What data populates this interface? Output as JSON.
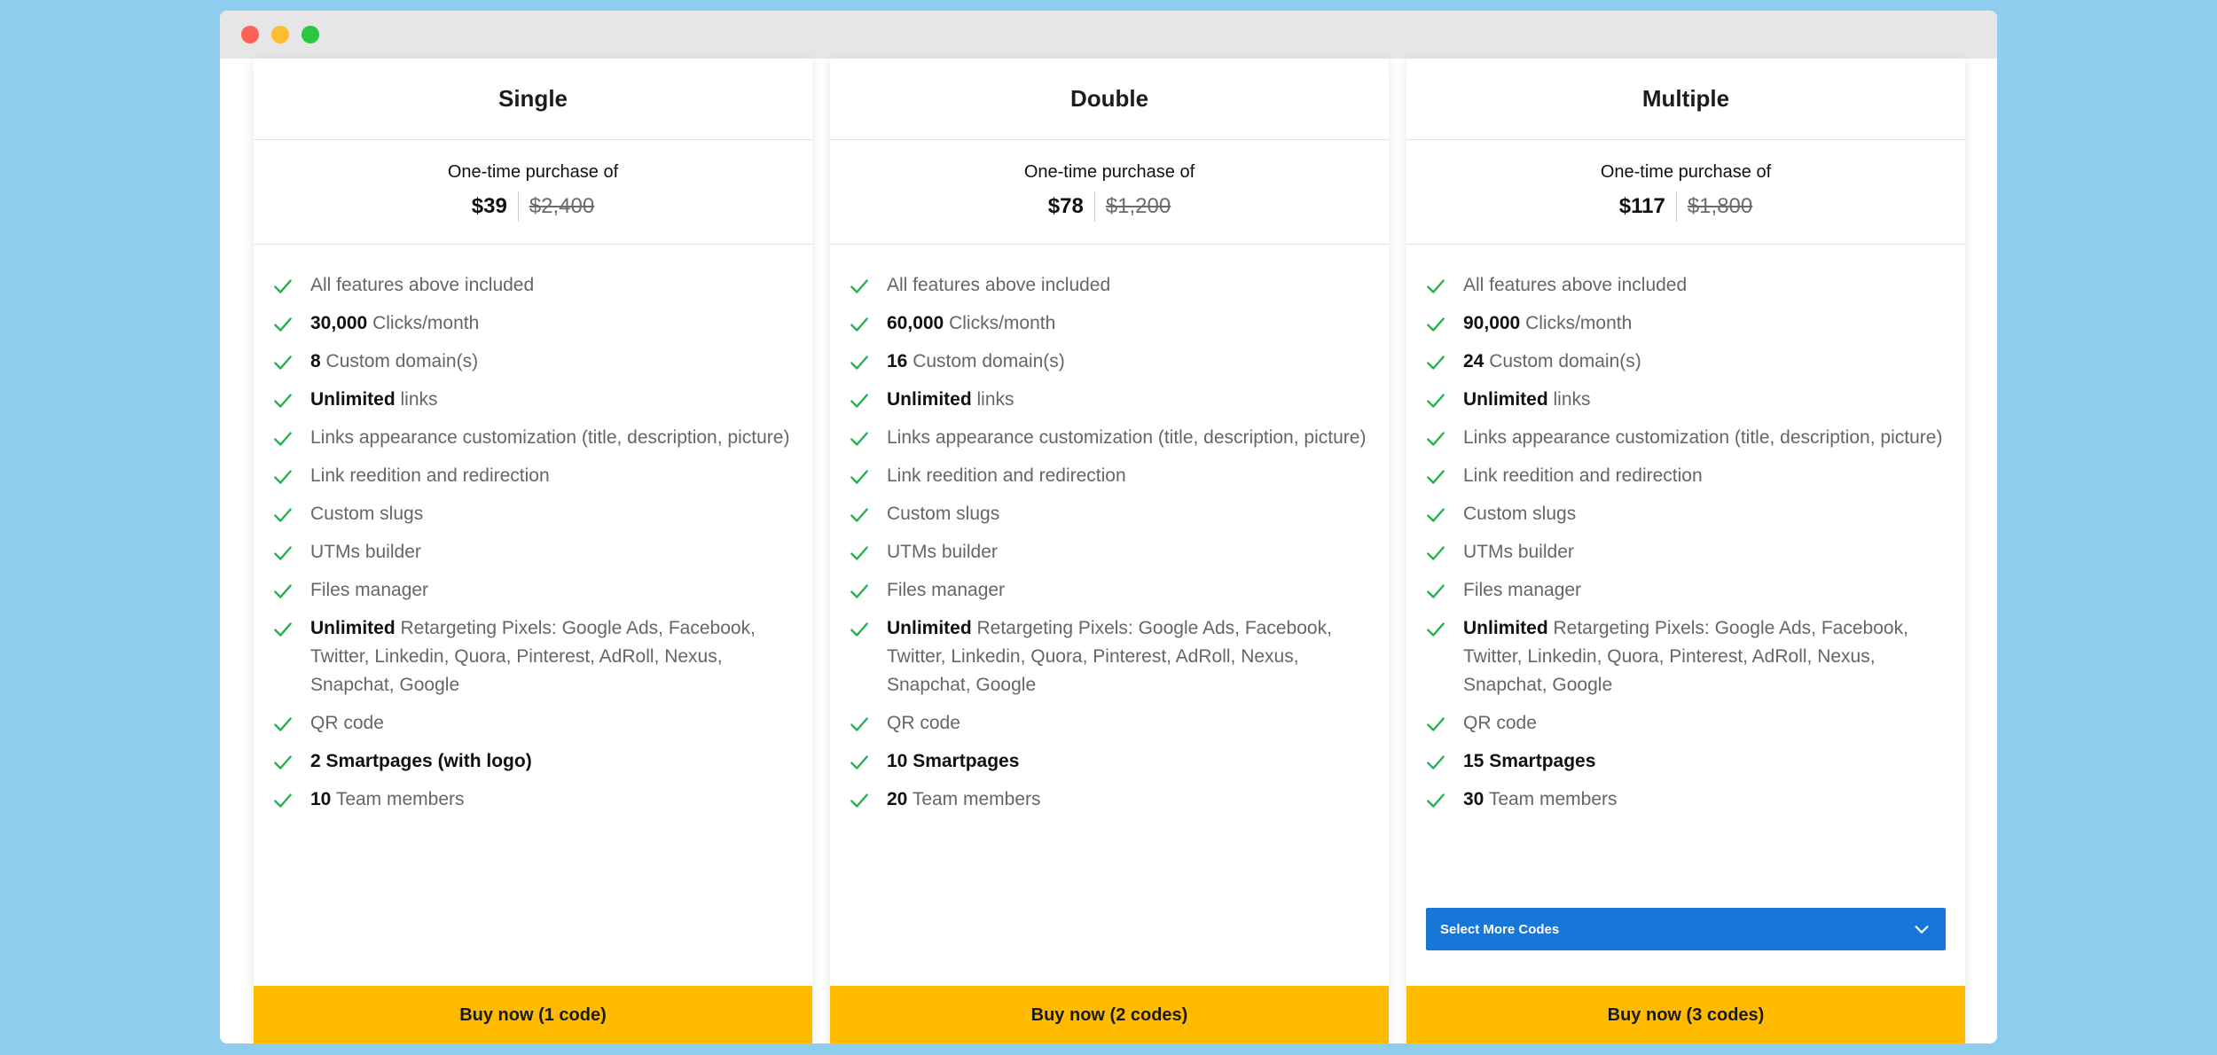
{
  "colors": {
    "accent_blue": "#1677d9",
    "buy_yellow": "#ffbb00",
    "check_green": "#23b14d",
    "background": "#8ecdee"
  },
  "icons": {
    "feature_check": "check-icon",
    "dropdown": "chevron-down-icon"
  },
  "plans": [
    {
      "title": "Single",
      "price_caption": "One-time purchase of",
      "price_now": "$39",
      "price_old": "$2,400",
      "features": [
        {
          "strong": "",
          "text": "All features above included"
        },
        {
          "strong": "30,000",
          "text": " Clicks/month"
        },
        {
          "strong": "8",
          "text": " Custom domain(s)"
        },
        {
          "strong": "Unlimited",
          "text": " links"
        },
        {
          "strong": "",
          "text": "Links appearance customization (title, description, picture)"
        },
        {
          "strong": "",
          "text": "Link reedition and redirection"
        },
        {
          "strong": "",
          "text": "Custom slugs"
        },
        {
          "strong": "",
          "text": "UTMs builder"
        },
        {
          "strong": "",
          "text": "Files manager"
        },
        {
          "strong": "Unlimited",
          "text": " Retargeting Pixels: Google Ads, Facebook, Twitter, Linkedin, Quora, Pinterest, AdRoll, Nexus, Snapchat, Google"
        },
        {
          "strong": "",
          "text": "QR code"
        },
        {
          "strong": "2 Smartpages (with logo)",
          "text": ""
        },
        {
          "strong": "10",
          "text": " Team members"
        }
      ],
      "select_label": "",
      "buy_label": "Buy now (1 code)"
    },
    {
      "title": "Double",
      "price_caption": "One-time purchase of",
      "price_now": "$78",
      "price_old": "$1,200",
      "features": [
        {
          "strong": "",
          "text": "All features above included"
        },
        {
          "strong": "60,000",
          "text": " Clicks/month"
        },
        {
          "strong": "16",
          "text": " Custom domain(s)"
        },
        {
          "strong": "Unlimited",
          "text": " links"
        },
        {
          "strong": "",
          "text": "Links appearance customization (title, description, picture)"
        },
        {
          "strong": "",
          "text": "Link reedition and redirection"
        },
        {
          "strong": "",
          "text": "Custom slugs"
        },
        {
          "strong": "",
          "text": "UTMs builder"
        },
        {
          "strong": "",
          "text": "Files manager"
        },
        {
          "strong": "Unlimited",
          "text": " Retargeting Pixels: Google Ads, Facebook, Twitter, Linkedin, Quora, Pinterest, AdRoll, Nexus, Snapchat, Google"
        },
        {
          "strong": "",
          "text": "QR code"
        },
        {
          "strong": "10 Smartpages",
          "text": ""
        },
        {
          "strong": "20",
          "text": " Team members"
        }
      ],
      "select_label": "",
      "buy_label": "Buy now (2 codes)"
    },
    {
      "title": "Multiple",
      "price_caption": "One-time purchase of",
      "price_now": "$117",
      "price_old": "$1,800",
      "features": [
        {
          "strong": "",
          "text": "All features above included"
        },
        {
          "strong": "90,000",
          "text": " Clicks/month"
        },
        {
          "strong": "24",
          "text": " Custom domain(s)"
        },
        {
          "strong": "Unlimited",
          "text": " links"
        },
        {
          "strong": "",
          "text": "Links appearance customization (title, description, picture)"
        },
        {
          "strong": "",
          "text": "Link reedition and redirection"
        },
        {
          "strong": "",
          "text": "Custom slugs"
        },
        {
          "strong": "",
          "text": "UTMs builder"
        },
        {
          "strong": "",
          "text": "Files manager"
        },
        {
          "strong": "Unlimited",
          "text": " Retargeting Pixels: Google Ads, Facebook, Twitter, Linkedin, Quora, Pinterest, AdRoll, Nexus, Snapchat, Google"
        },
        {
          "strong": "",
          "text": "QR code"
        },
        {
          "strong": "15 Smartpages",
          "text": ""
        },
        {
          "strong": "30",
          "text": " Team members"
        }
      ],
      "select_label": "Select More Codes",
      "buy_label": "Buy now (3 codes)"
    }
  ]
}
